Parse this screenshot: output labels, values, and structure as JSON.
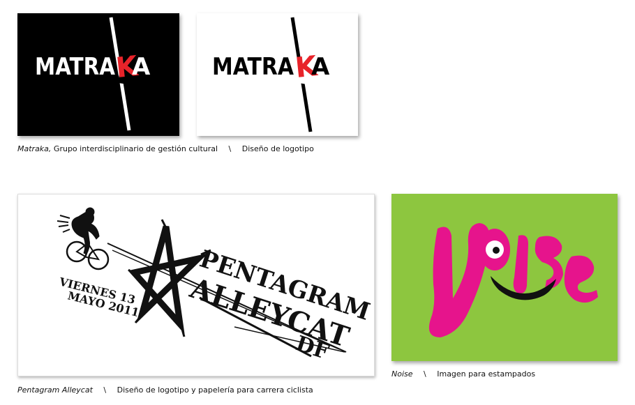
{
  "works": [
    {
      "logo_word_left": "MATRA",
      "logo_letter": "K",
      "logo_word_right": "A",
      "caption_name": "Matraka,",
      "caption_desc": "Grupo interdisciplinario de gestión cultural",
      "caption_sep": "\\",
      "caption_type": "Diseño de logotipo"
    },
    {
      "logo_lines": [
        "PENTAGRAM",
        "ALLEYCAT",
        "DF"
      ],
      "date_lines": [
        "VIERNES 13",
        "MAYO 2011"
      ],
      "caption_name": "Pentagram Alleycat",
      "caption_sep": "\\",
      "caption_type": "Diseño de logotipo y papelería para carrera ciclista"
    },
    {
      "caption_name": "Noise",
      "caption_sep": "\\",
      "caption_type": "Imagen para estampados"
    }
  ],
  "colors": {
    "matraka_red": "#e8232a",
    "noise_bg": "#8dc63f",
    "noise_pink": "#e6148c"
  }
}
